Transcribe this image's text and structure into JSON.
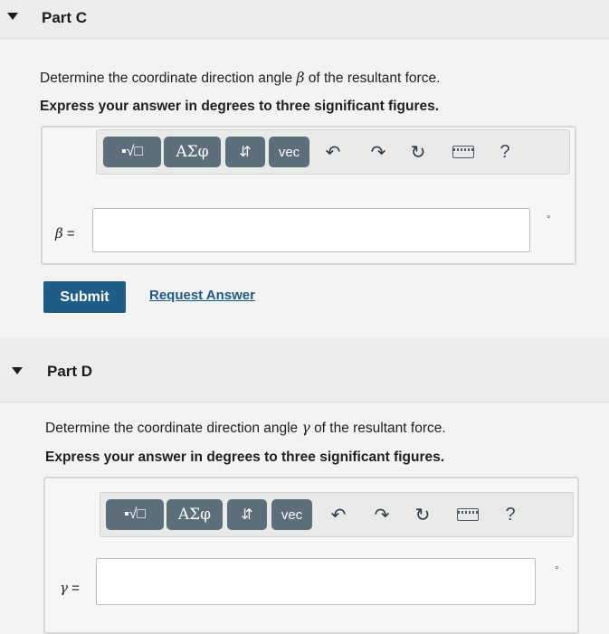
{
  "part_c": {
    "title": "Part C",
    "question_prefix": "Determine the coordinate direction angle",
    "question_symbol": "β",
    "question_suffix": "of the resultant force.",
    "instruction": "Express your answer in degrees to three significant figures.",
    "variable_symbol": "β",
    "variable_equals": "=",
    "input_value": "",
    "unit": "°",
    "submit_label": "Submit",
    "request_label": "Request Answer"
  },
  "part_d": {
    "title": "Part D",
    "question_prefix": "Determine the coordinate direction angle",
    "question_symbol": "γ",
    "question_suffix": "of the resultant force.",
    "instruction": "Express your answer in degrees to three significant figures.",
    "variable_symbol": "γ",
    "variable_equals": "=",
    "input_value": "",
    "unit": "°"
  },
  "toolbar": {
    "templates_label": "▪√□",
    "greek_label": "ΑΣφ",
    "sort_label": "⇵",
    "vec_label": "vec",
    "help_label": "?",
    "icons": [
      "templates-icon",
      "greek-icon",
      "sort-icon",
      "undo-icon",
      "redo-icon",
      "reset-icon",
      "keyboard-icon",
      "help-icon"
    ]
  }
}
